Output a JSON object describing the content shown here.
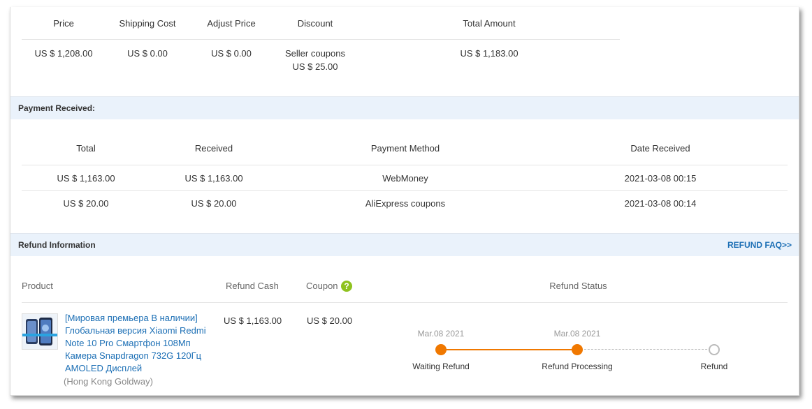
{
  "summary": {
    "headers": [
      "Price",
      "Shipping Cost",
      "Adjust Price",
      "Discount",
      "Total Amount"
    ],
    "price": "US $ 1,208.00",
    "shipping": "US $ 0.00",
    "adjust": "US $ 0.00",
    "discount_label": "Seller coupons",
    "discount_value": "US $ 25.00",
    "total": "US $ 1,183.00"
  },
  "payment": {
    "title": "Payment Received:",
    "headers": [
      "Total",
      "Received",
      "Payment Method",
      "Date Received"
    ],
    "rows": [
      [
        "US $ 1,163.00",
        "US $ 1,163.00",
        "WebMoney",
        "2021-03-08 00:15"
      ],
      [
        "US $ 20.00",
        "US $ 20.00",
        "AliExpress coupons",
        "2021-03-08 00:14"
      ]
    ]
  },
  "refund": {
    "title": "Refund Information",
    "faq": "REFUND FAQ>>",
    "headers": {
      "product": "Product",
      "cash": "Refund Cash",
      "coupon": "Coupon",
      "status": "Refund Status"
    },
    "help_icon": "?",
    "product_lines": [
      "[Мировая премьера В наличии]",
      "Глобальная версия Xiaomi Redmi",
      "Note 10 Pro Смартфон 108Мп",
      "Камера Snapdragon 732G 120Гц",
      "AMOLED Дисплей"
    ],
    "store": "(Hong Kong Goldway)",
    "cash": "US $ 1,163.00",
    "coupon": "US $ 20.00",
    "steps": [
      {
        "date": "Mar.08 2021",
        "label": "Waiting Refund",
        "done": true
      },
      {
        "date": "Mar.08 2021",
        "label": "Refund Processing",
        "done": true
      },
      {
        "date": "",
        "label": "Refund",
        "done": false
      }
    ],
    "colors": {
      "accent": "#f07800",
      "link": "#1c6fb5",
      "help": "#8fc21f"
    }
  }
}
